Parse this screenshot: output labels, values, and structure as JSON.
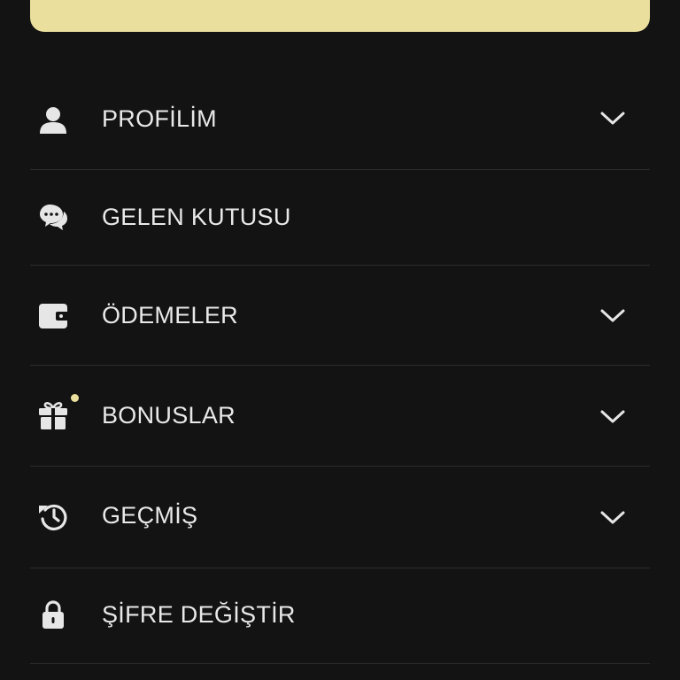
{
  "theme": {
    "background": "#131313",
    "accent": "#ebdf9d",
    "text": "#e9e9e9",
    "icon": "#e6e6e6",
    "divider": "#2c2c2c"
  },
  "menu": {
    "items": [
      {
        "label": "PROFİLİM",
        "icon": "user-icon",
        "expandable": true
      },
      {
        "label": "GELEN KUTUSU",
        "icon": "chat-bubbles-icon",
        "expandable": false
      },
      {
        "label": "ÖDEMELER",
        "icon": "wallet-icon",
        "expandable": true
      },
      {
        "label": "BONUSLAR",
        "icon": "gift-icon",
        "expandable": true,
        "notification": true
      },
      {
        "label": "GEÇMİŞ",
        "icon": "history-icon",
        "expandable": true
      },
      {
        "label": "ŞİFRE DEĞİŞTİR",
        "icon": "lock-icon",
        "expandable": false
      }
    ]
  }
}
